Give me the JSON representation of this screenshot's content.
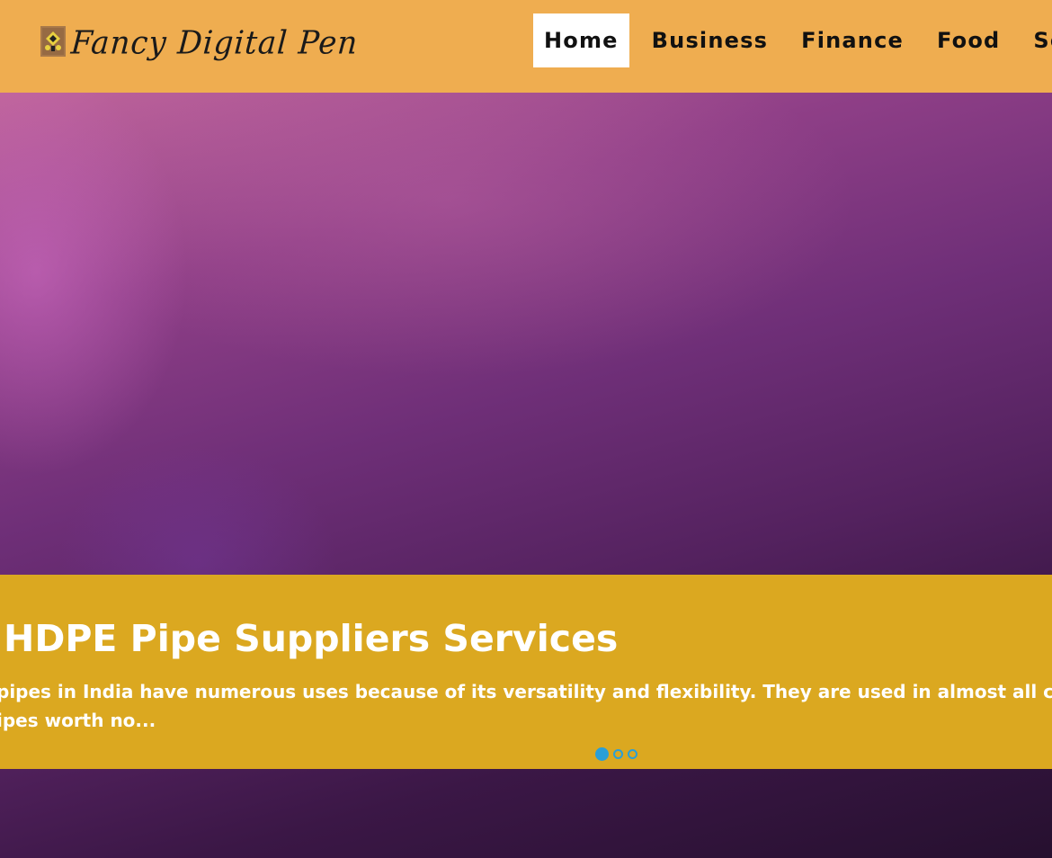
{
  "site": {
    "logo_text": "Fancy Digital Pen",
    "logo_icon": "pen-logo-icon"
  },
  "nav": {
    "items": [
      {
        "label": "Home",
        "active": true
      },
      {
        "label": "Business",
        "active": false
      },
      {
        "label": "Finance",
        "active": false
      },
      {
        "label": "Food",
        "active": false
      },
      {
        "label": "Socc",
        "active": false
      }
    ]
  },
  "slider": {
    "title": "HDPE Pipe Suppliers Services",
    "excerpt_line1": "pipes in India have numerous uses because of its versatility and flexibility. They are used in almost all consum",
    "excerpt_line2": "ipes worth no...",
    "dots": [
      {
        "active": true
      },
      {
        "active": false
      },
      {
        "active": false
      }
    ]
  },
  "colors": {
    "header_bg": "#efad50",
    "caption_bg": "#dba820",
    "dot_accent": "#2a9fd6"
  }
}
